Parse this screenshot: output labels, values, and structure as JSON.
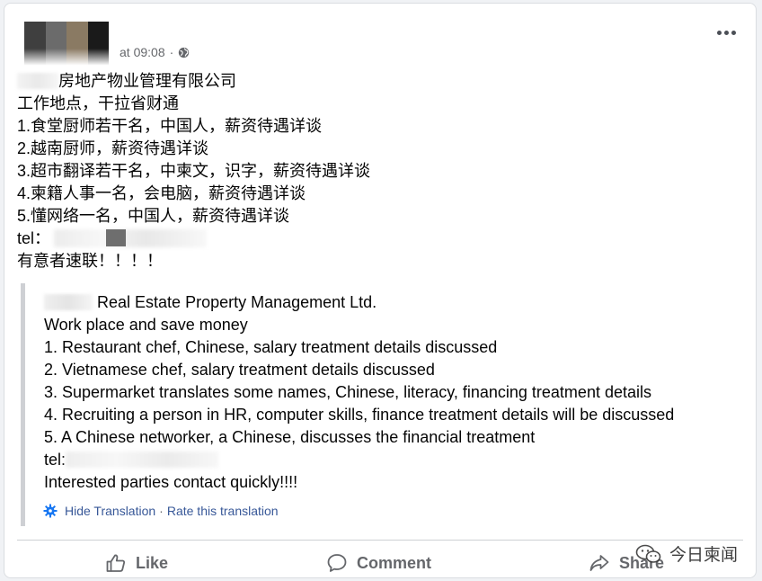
{
  "post": {
    "timestamp": "at 09:08",
    "separator": "·",
    "lines_cn": [
      "房地产物业管理有限公司",
      "工作地点，干拉省财通",
      "1.食堂厨师若干名，中国人，薪资待遇详谈",
      "2.越南厨师，薪资待遇详谈",
      "3.超市翻译若干名，中柬文，识字，薪资待遇详谈",
      "4.柬籍人事一名，会电脑，薪资待遇详谈",
      "5.懂网络一名，中国人，薪资待遇详谈"
    ],
    "tel_label": "tel：",
    "closing": "有意者速联！！！！"
  },
  "translation": {
    "title_suffix": "Real Estate Property Management Ltd.",
    "lines": [
      "Work place and save money",
      "1. Restaurant chef, Chinese, salary treatment details discussed",
      "2. Vietnamese chef, salary treatment details discussed",
      "3. Supermarket translates some names, Chinese, literacy, financing treatment details",
      "4. Recruiting a person in HR, computer skills, finance treatment details will be discussed",
      "5. A Chinese networker, a Chinese, discusses the financial treatment"
    ],
    "tel_label": "tel:",
    "closing": "Interested parties contact quickly!!!!",
    "hide_link": "Hide Translation",
    "link_separator": "·",
    "rate_link": "Rate this translation"
  },
  "actions": {
    "like": "Like",
    "comment": "Comment",
    "share": "Share"
  },
  "watermark": {
    "text": "今日柬闻"
  },
  "icons": {
    "privacy": "globe-icon",
    "menu": "more-options-icon",
    "settings": "cog-icon",
    "like": "thumbs-up-icon",
    "comment": "comment-bubble-icon",
    "share": "share-arrow-icon",
    "watermark": "wechat-icon"
  },
  "colors": {
    "link": "#385898",
    "muted": "#65676b",
    "text": "#050505",
    "quote_bar": "#ced0d4",
    "settings_icon": "#1877f2"
  }
}
